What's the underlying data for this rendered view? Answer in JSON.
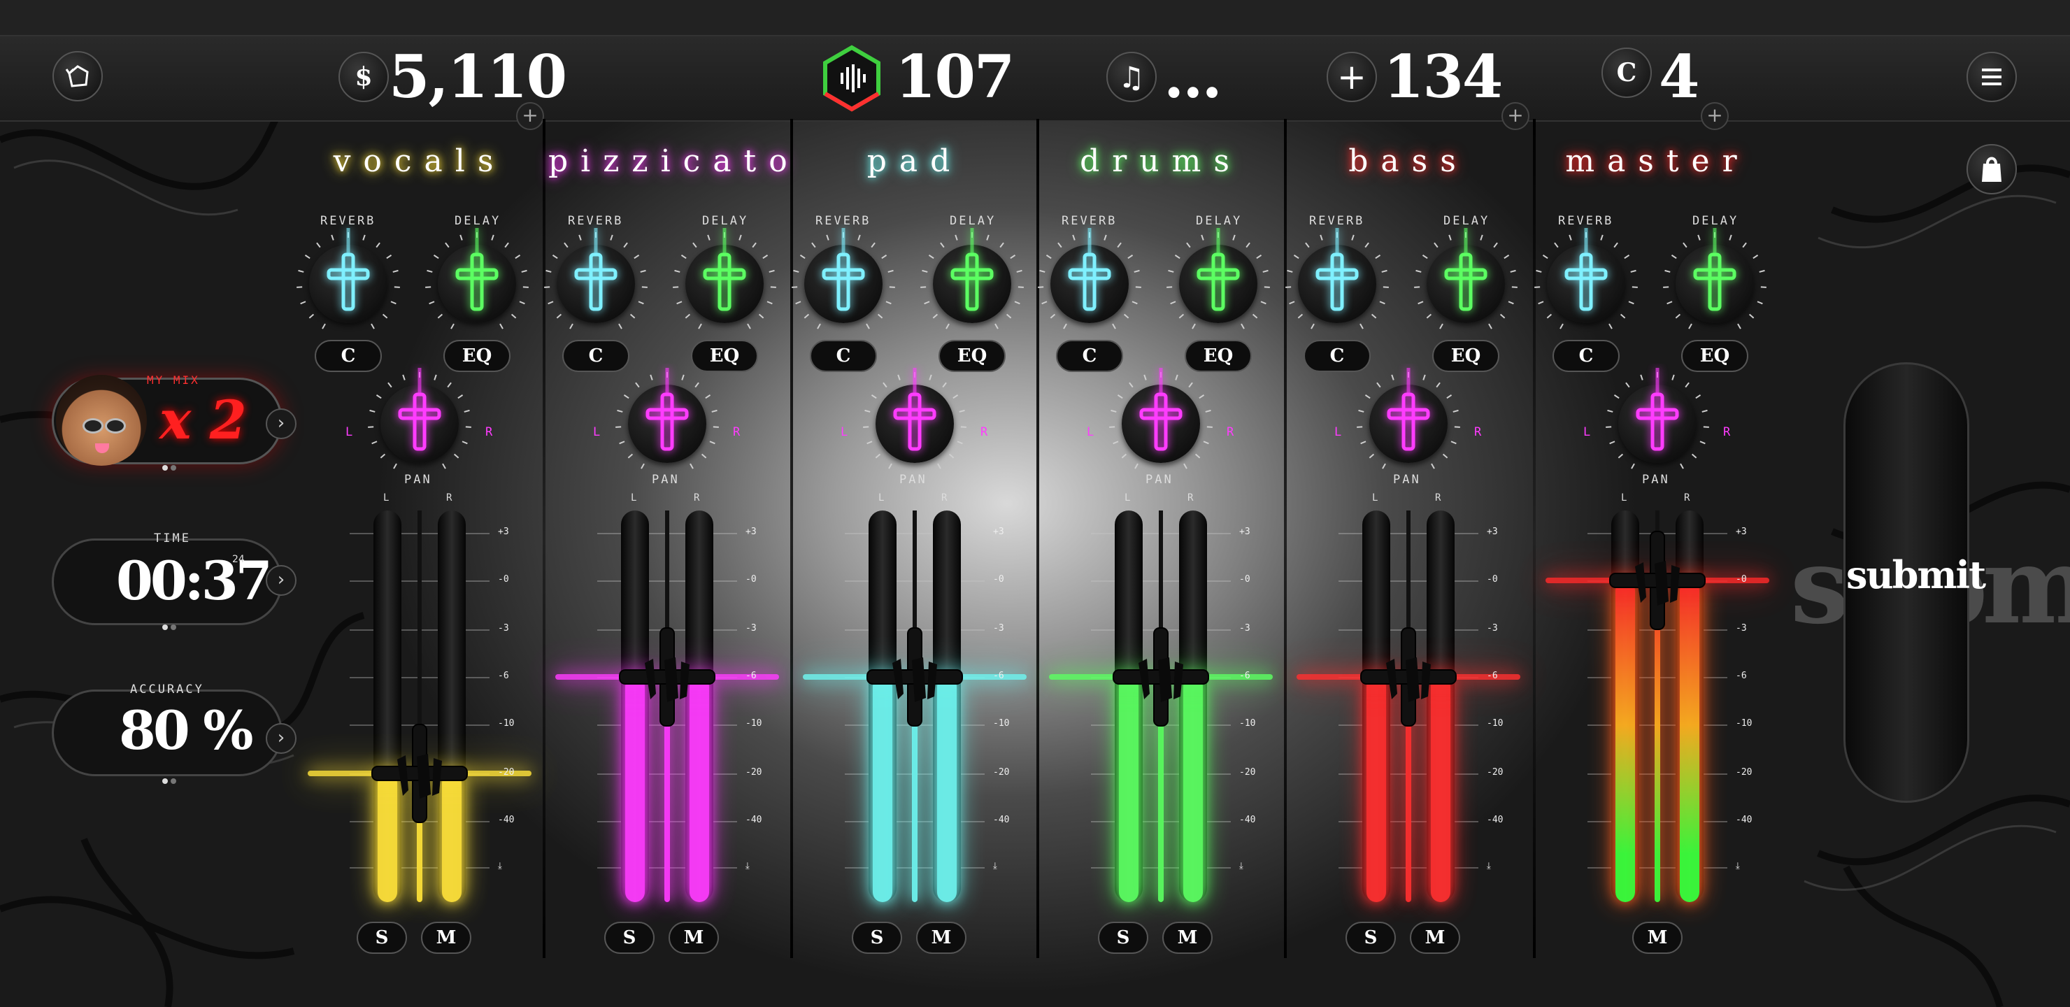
{
  "top": {
    "money": "5,110",
    "money_symbol": "$",
    "record_count": "107",
    "song_status": "...",
    "plus_count": "134",
    "c_count": "4",
    "c_symbol": "C",
    "plus_small": "+"
  },
  "side": {
    "mix_label": "MY MIX",
    "mix_multiplier": "x 2",
    "time_label": "TIME",
    "time_value": "00:37",
    "time_sup": "24",
    "accuracy_label": "ACCURACY",
    "accuracy_value": "80 %",
    "arrow": "›"
  },
  "labels": {
    "reverb": "REVERB",
    "delay": "DELAY",
    "pan": "PAN",
    "left": "L",
    "right": "R",
    "c": "C",
    "eq": "EQ",
    "solo": "S",
    "mute": "M"
  },
  "scale": [
    "+3",
    "-0",
    "-3",
    "-6",
    "-10",
    "-20",
    "-40",
    "⤓"
  ],
  "channels": [
    {
      "name": "vocals",
      "color": "#ffe23a",
      "level_db": "-20",
      "solo": "S",
      "mute": "M"
    },
    {
      "name": "pizzicato",
      "color": "#ff3cff",
      "level_db": "-6",
      "solo": "S",
      "mute": "M"
    },
    {
      "name": "pad",
      "color": "#6ff5f0",
      "level_db": "-6",
      "solo": "S",
      "mute": "M"
    },
    {
      "name": "drums",
      "color": "#5cff62",
      "level_db": "-6",
      "solo": "S",
      "mute": "M"
    },
    {
      "name": "bass",
      "color": "#ff3030",
      "level_db": "-6",
      "solo": "S",
      "mute": "M"
    },
    {
      "name": "master",
      "color": "#ff2a2a",
      "level_db": "-0",
      "mute": "M"
    }
  ],
  "colors": {
    "reverb": "#7ff0ff",
    "delay": "#5cff62",
    "pan": "#ff3cff"
  },
  "submit": {
    "label": "submit"
  }
}
